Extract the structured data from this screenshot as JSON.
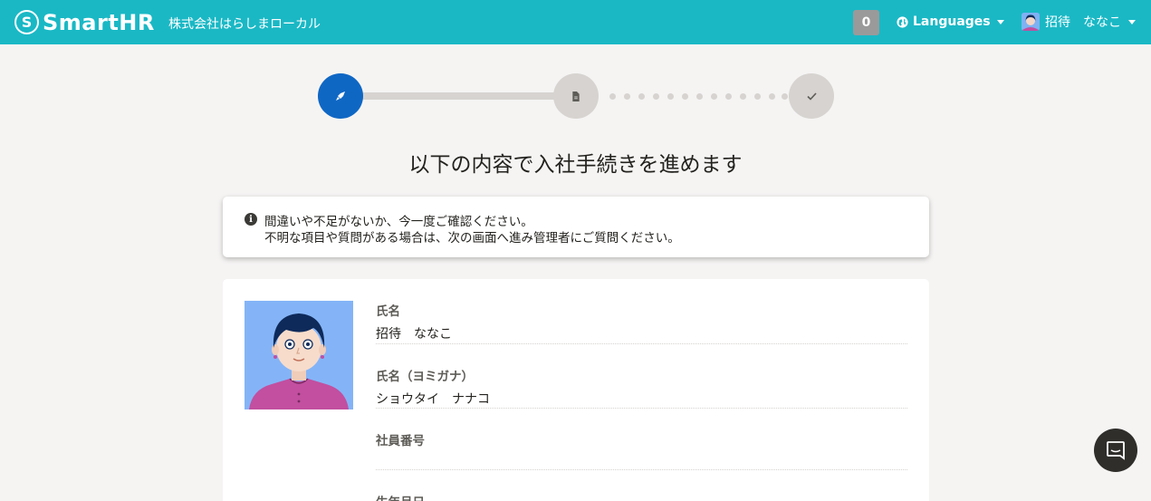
{
  "header": {
    "logo_mark": "S",
    "logo_text": "SmartHR",
    "company": "株式会社はらしまローカル",
    "notification_count": "0",
    "languages_label": "Languages",
    "user_name": "招待　ななこ"
  },
  "stepper": {
    "current_step": 1,
    "total_steps": 3
  },
  "page_title": "以下の内容で入社手続きを進めます",
  "info": {
    "icon": "info-icon",
    "line1": "間違いや不足がないか、今一度ご確認ください。",
    "line2": "不明な項目や質問がある場合は、次の画面へ進み管理者にご質問ください。"
  },
  "fields": [
    {
      "label": "氏名",
      "value": "招待　ななこ"
    },
    {
      "label": "氏名（ヨミガナ）",
      "value": "ショウタイ　ナナコ"
    },
    {
      "label": "社員番号",
      "value": ""
    },
    {
      "label": "生年月日",
      "value": ""
    }
  ],
  "colors": {
    "header_bg": "#1ab8c5",
    "step_active": "#0f67c4",
    "step_inactive": "#d6d3d0",
    "page_bg": "#f5f4f3"
  }
}
